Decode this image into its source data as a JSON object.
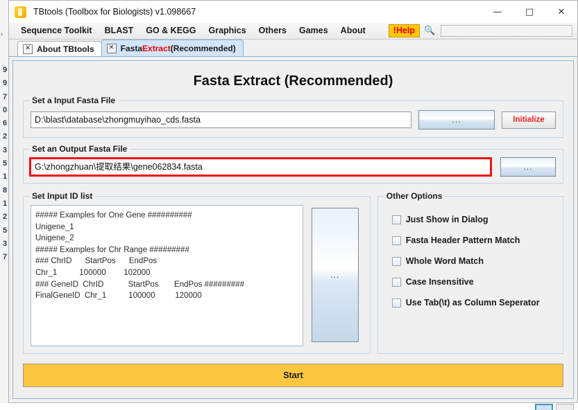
{
  "window": {
    "title": "TBtools (Toolbox for Biologists) v1.098667",
    "icon": "tbtools-logo-icon",
    "controls": {
      "minimize": "—",
      "maximize": "□",
      "close": "✕"
    }
  },
  "menu": {
    "items": [
      {
        "label": "Sequence Toolkit"
      },
      {
        "label": "BLAST"
      },
      {
        "label": "GO & KEGG"
      },
      {
        "label": "Graphics"
      },
      {
        "label": "Others"
      },
      {
        "label": "Games"
      },
      {
        "label": "About"
      }
    ],
    "help_label": "!Help",
    "help_bg": "#ffc800",
    "help_color": "#e8000d",
    "search_icon": "magnifier-icon",
    "search_value": "",
    "search_placeholder": ""
  },
  "tabs": [
    {
      "label": "About TBtools",
      "active": false,
      "close": "✕"
    },
    {
      "label_parts": [
        "Fasta ",
        "Extract",
        " (Recommended)"
      ],
      "label": "Fasta Extract (Recommended)",
      "active": true,
      "close": "✕",
      "accent_color": "#ee0000"
    }
  ],
  "page": {
    "title": "Fasta Extract (Recommended)"
  },
  "input_group": {
    "title": "Set a Input Fasta File",
    "path_value": "D:\\blast\\database\\zhongmuyihao_cds.fasta",
    "path_placeholder": "",
    "browse_label": "...",
    "initialize_label": "Initialize",
    "initialize_color": "#ee2222"
  },
  "output_group": {
    "title": "Set an Output Fasta File",
    "path_value": "G:\\zhongzhuan\\提取结果\\gene062834.fasta",
    "path_placeholder": "",
    "highlight_color": "#ee1111",
    "browse_label": "..."
  },
  "idlist_group": {
    "title": "Set Input ID list",
    "textarea_value": "##### Examples for One Gene ##########\nUnigene_1\nUnigene_2\n##### Examples for Chr Range #########\n### ChrID      StartPos      EndPos\nChr_1          100000        102000\n### GeneID  ChrID           StartPos       EndPos #########\nFinalGeneID  Chr_1          100000         120000",
    "browse_label": "..."
  },
  "options_group": {
    "title": "Other Options",
    "checkboxes": [
      {
        "label": "Just Show in Dialog",
        "checked": false
      },
      {
        "label": "Fasta Header Pattern Match",
        "checked": false
      },
      {
        "label": "Whole Word Match",
        "checked": false
      },
      {
        "label": "Case Insensitive",
        "checked": false
      },
      {
        "label": "Use Tab(\\t) as Column Seperator",
        "checked": false
      }
    ]
  },
  "start_button": {
    "label": "Start",
    "bg_color": "#fcc73f"
  },
  "background_window": {
    "digits": "9\n9\n7\n0\n6\n2\n3\n5\n1\n8\n1\n2\n5\n3\n7",
    "arrow": "›"
  }
}
